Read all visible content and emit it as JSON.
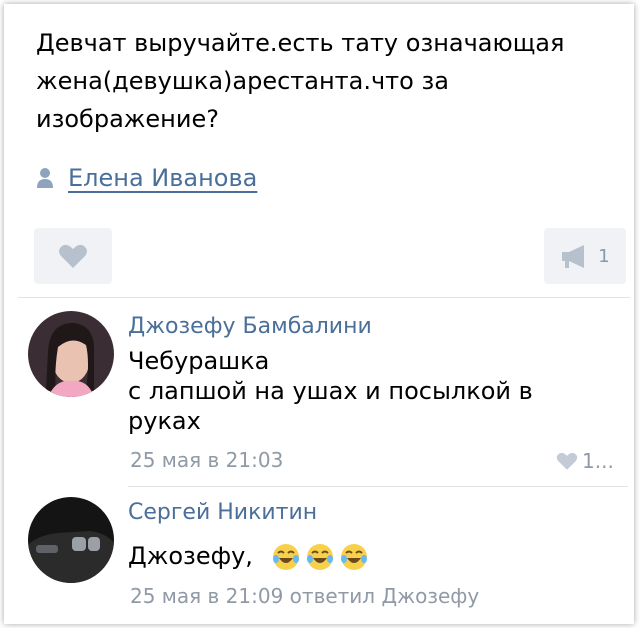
{
  "post": {
    "text_lines": [
      "Девчат выручайте.есть тату означающая",
      "жена(девушка)арестанта.что за",
      "изображение?"
    ],
    "author": "Елена Иванова",
    "share_count": "1",
    "icons": [
      "user-icon",
      "heart-icon",
      "megaphone-icon"
    ]
  },
  "comments": [
    {
      "name": "Джозефу Бамбалини",
      "text_lines": [
        "Чебурашка",
        "с лапшой на ушах и посылкой в",
        "руках"
      ],
      "date": "25 мая в 21:03",
      "likes": "1..."
    },
    {
      "name": "Сергей Никитин",
      "text": "Джозефу,",
      "emoji": [
        "tears-of-joy-icon",
        "tears-of-joy-icon",
        "tears-of-joy-icon"
      ],
      "date": "25 мая в 21:09 ответил Джозефу"
    }
  ],
  "colors": {
    "link": "#4a6f99",
    "muted": "#909aa6",
    "button_bg": "#f0f2f5"
  }
}
